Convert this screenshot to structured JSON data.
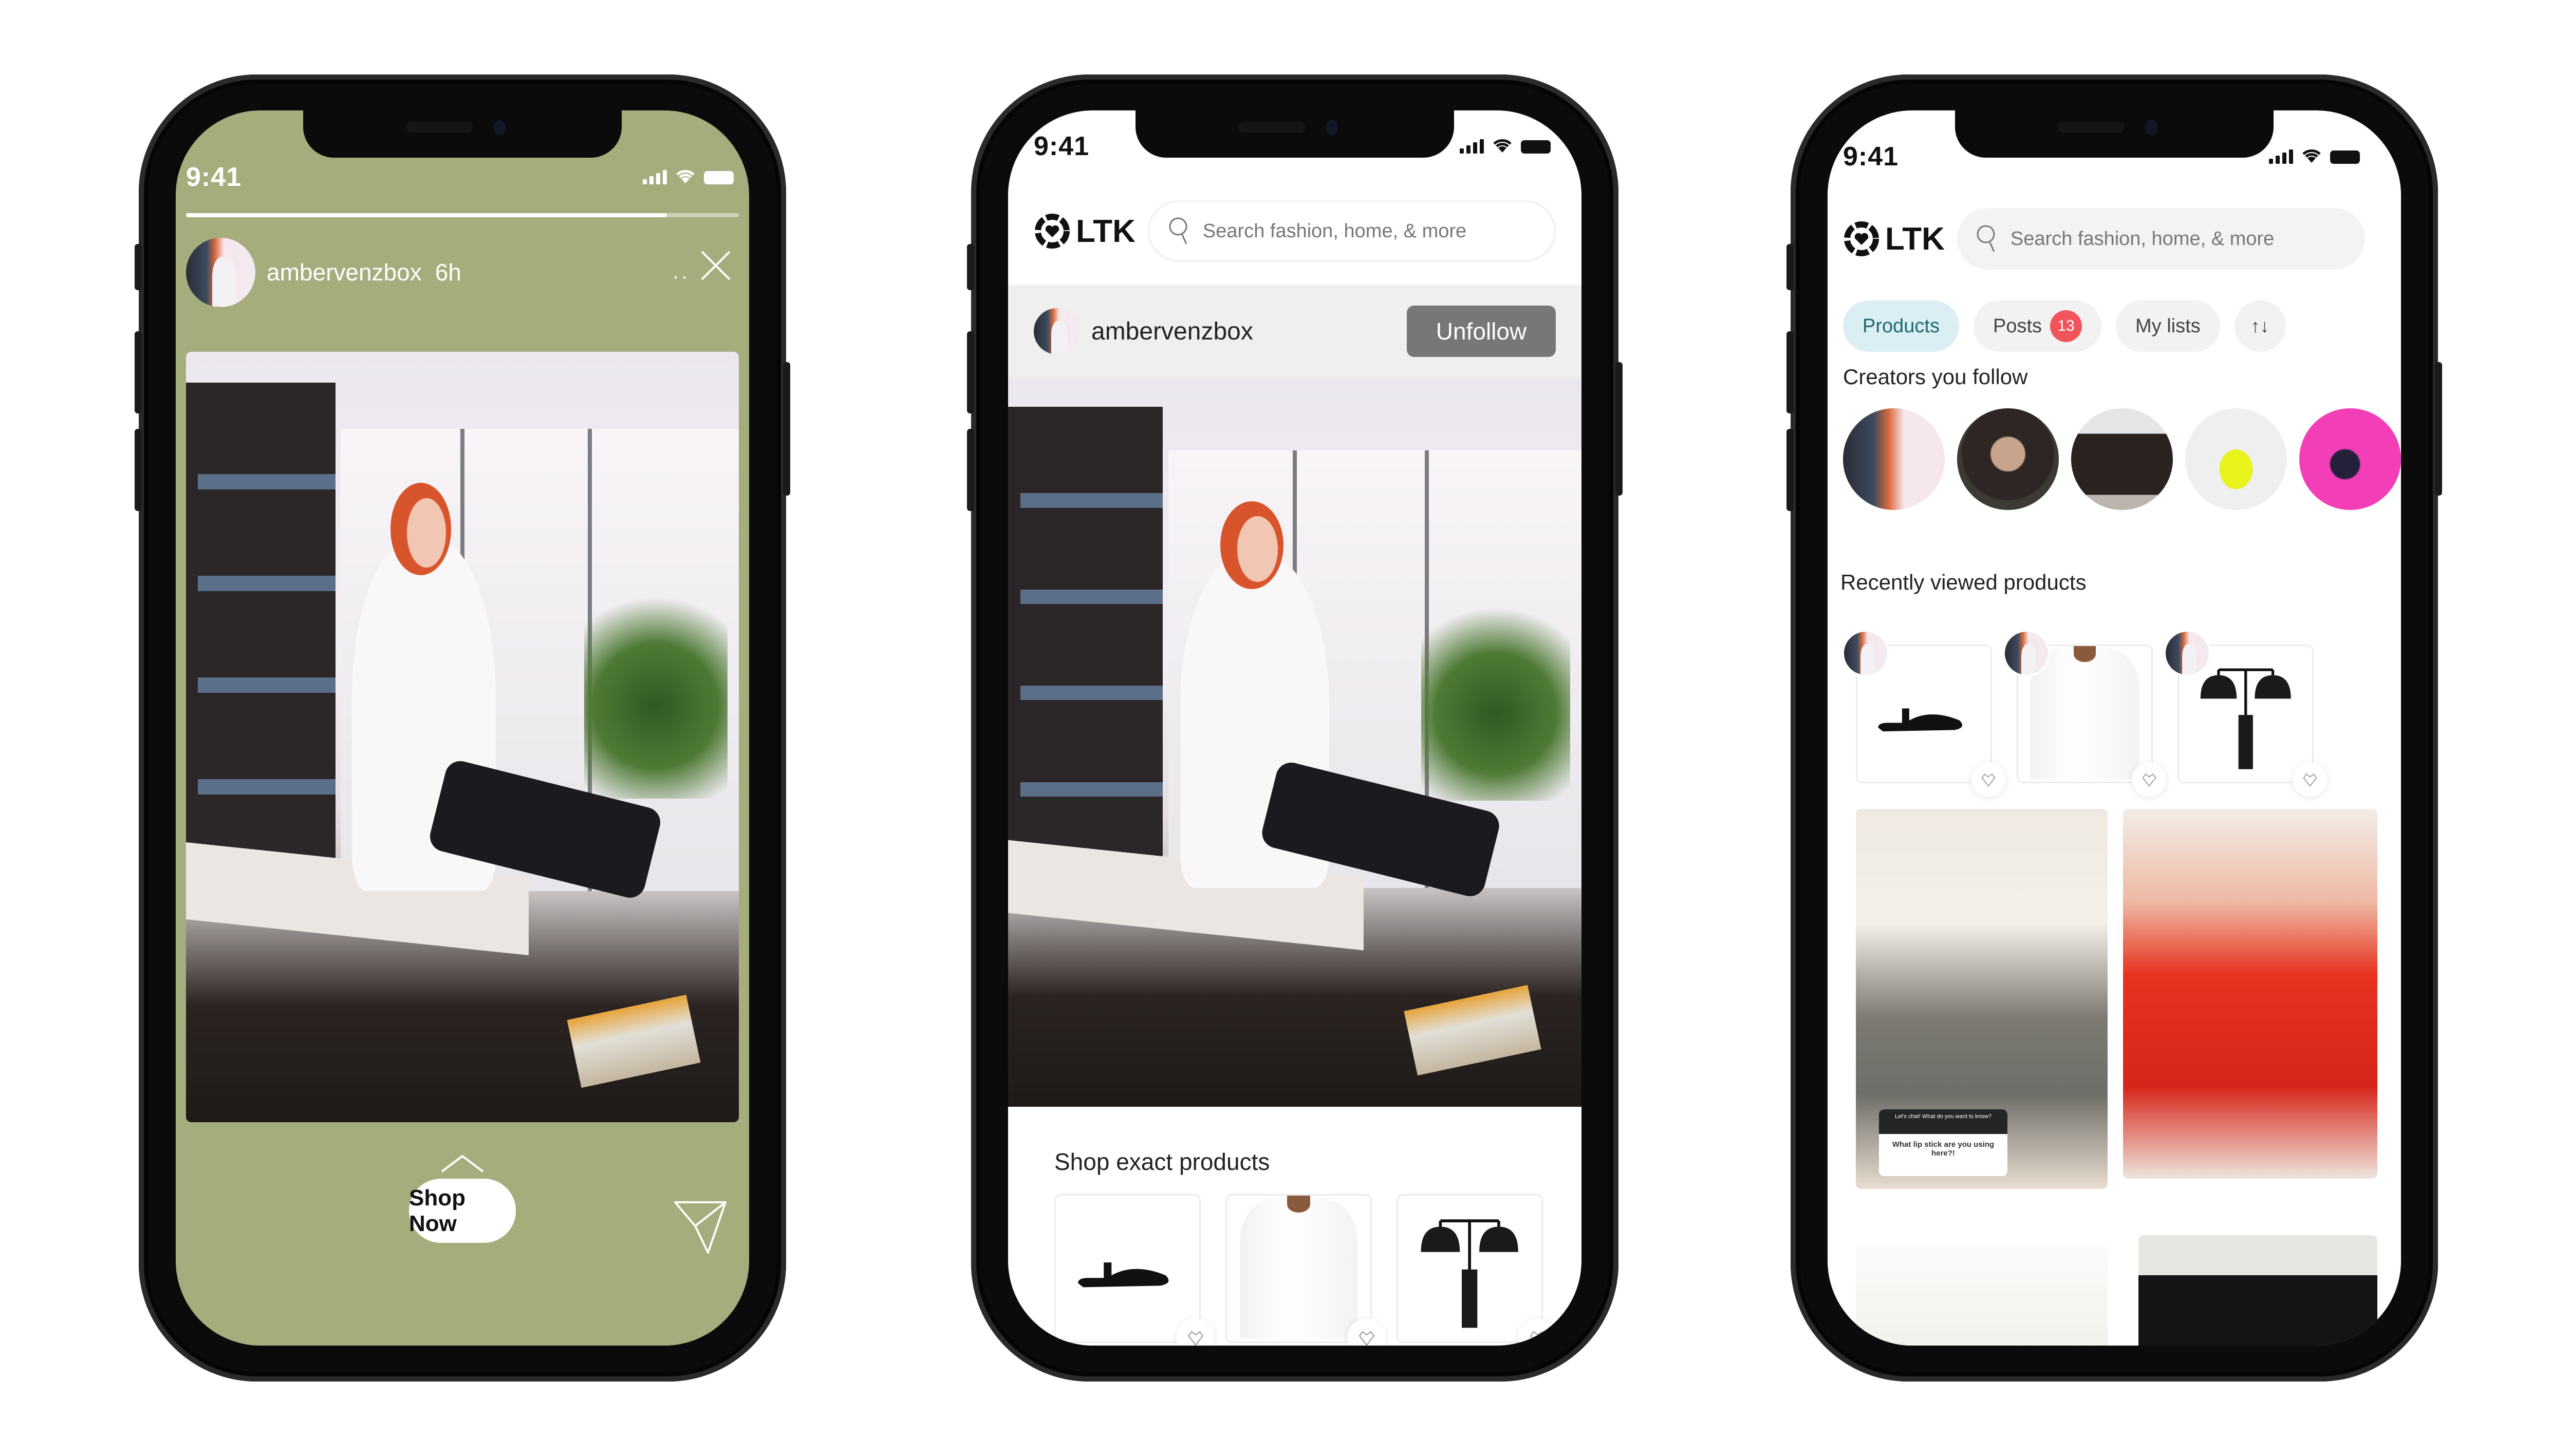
{
  "colors": {
    "story_bg": "#a6ad7d",
    "tab_active_bg": "#dbeef3",
    "tab_active_text": "#1d6a6a",
    "badge": "#f2545b",
    "unfollow_bg": "#777777"
  },
  "phones": [
    {
      "screen": "story",
      "status": {
        "time": "9:41"
      },
      "story": {
        "progress": 0.87,
        "username": "ambervenzbox",
        "posted": "6h",
        "more": "··",
        "close_icon": "close-icon",
        "cta": "Shop Now",
        "swipe_icon": "chevron-up-icon",
        "share_icon": "send-icon"
      }
    },
    {
      "screen": "post",
      "status": {
        "time": "9:41"
      },
      "brand": "LTK",
      "search_placeholder": "Search fashion, home, & more",
      "creator": {
        "username": "ambervenzbox",
        "follow_button": "Unfollow"
      },
      "section_title": "Shop exact products",
      "products": [
        {
          "name": "Black flat sandal",
          "icon": "shoe"
        },
        {
          "name": "White oversized shirt",
          "icon": "shirt"
        },
        {
          "name": "Black double-dome table lamp",
          "icon": "lamp"
        }
      ]
    },
    {
      "screen": "home",
      "status": {
        "time": "9:41"
      },
      "brand": "LTK",
      "search_placeholder": "Search fashion, home, & more",
      "tabs": [
        {
          "label": "Products",
          "active": true
        },
        {
          "label": "Posts",
          "badge": "13"
        },
        {
          "label": "My lists"
        },
        {
          "label": "↑↓",
          "icon": "sort-icon"
        }
      ],
      "creators_title": "Creators you follow",
      "creators_count": 5,
      "recent_title": "Recently viewed products",
      "recent_products": [
        "Black flat sandal",
        "White oversized shirt",
        "Black double-dome table lamp"
      ],
      "post_question": {
        "prompt": "Let's chat! What do you want to know?",
        "answer": "What lip stick are you using here?!"
      }
    }
  ]
}
